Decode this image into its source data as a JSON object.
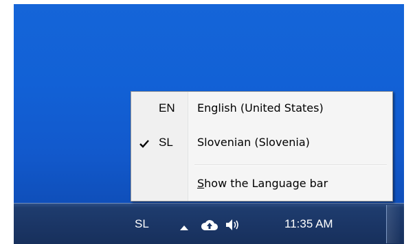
{
  "language_menu": {
    "items": [
      {
        "code": "EN",
        "label": "English (United States)",
        "checked": false
      },
      {
        "code": "SL",
        "label": "Slovenian (Slovenia)",
        "checked": true
      }
    ],
    "show_language_bar": {
      "mnemonic": "S",
      "rest": "how the Language bar"
    }
  },
  "taskbar": {
    "language_indicator": "SL",
    "clock": "11:35 AM",
    "tray_icons": [
      "show-hidden-icons-arrow-icon",
      "cloud-upload-icon",
      "volume-icon"
    ]
  },
  "colors": {
    "desktop": "#1261d6",
    "taskbar": "#1b3666",
    "menu_background": "#f5f5f5"
  }
}
